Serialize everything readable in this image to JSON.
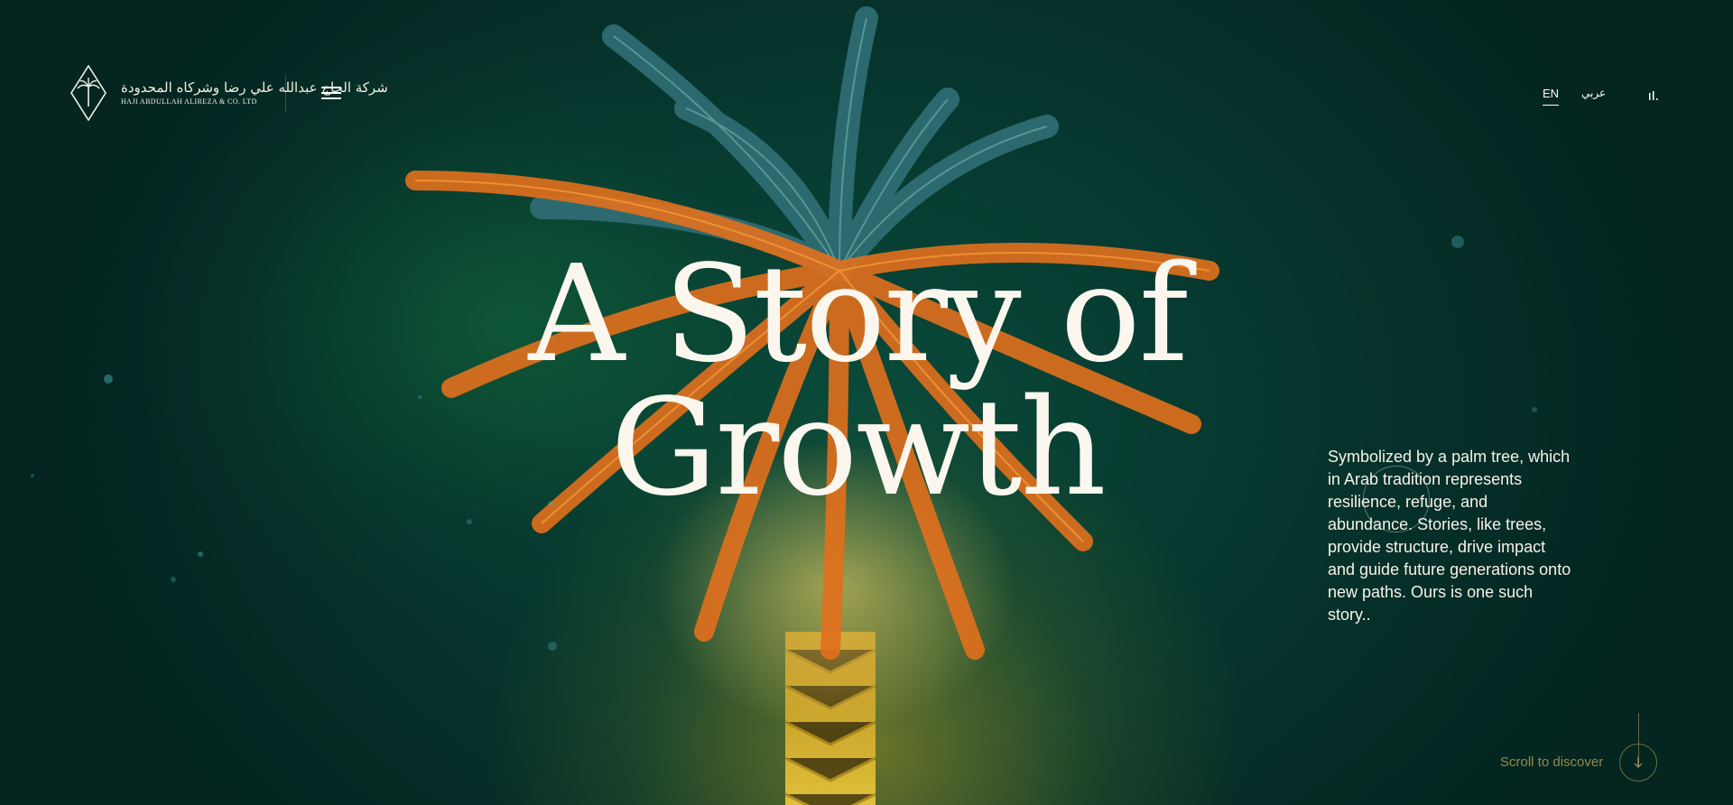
{
  "brand": {
    "arabic_name": "شركة الحاج عبدالله علي رضا وشركاه المحدودة",
    "english_name": "HAJI ABDULLAH ALIREZA & CO. LTD"
  },
  "nav": {
    "menu_icon": "hamburger-menu-icon",
    "languages": [
      {
        "code": "EN",
        "label": "EN",
        "active": true
      },
      {
        "code": "AR",
        "label": "عربي",
        "active": false
      }
    ],
    "audio_icon": "audio-bars-icon"
  },
  "hero": {
    "headline_line1": "A Story of",
    "headline_line2": "Growth",
    "intro": "Symbolized by a palm tree, which in Arab tradition represents resilience, refuge, and abundance. Stories, like trees, provide structure, drive impact and guide future generations onto new paths. Ours is one such story.."
  },
  "scroll": {
    "label": "Scroll to discover",
    "icon": "arrow-down-icon"
  },
  "colors": {
    "background": "#052a25",
    "frond_teal": "#2d6f72",
    "frond_orange": "#e8741f",
    "trunk_gold": "#c8a22a",
    "accent_gold": "#c8aa5a"
  }
}
